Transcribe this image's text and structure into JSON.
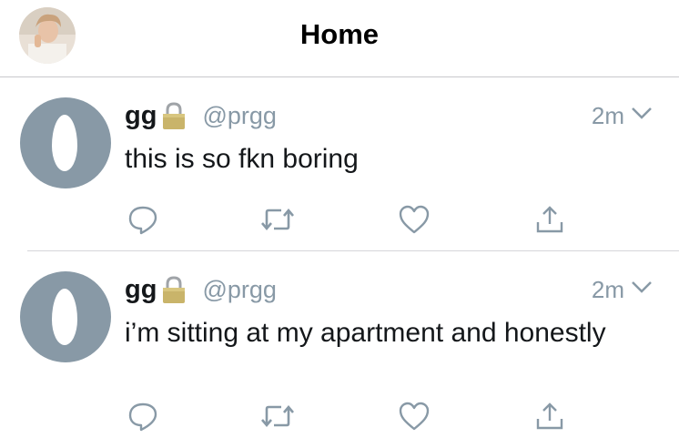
{
  "header": {
    "title": "Home"
  },
  "tweets": [
    {
      "display_name": "gg",
      "handle": "@prgg",
      "time": "2m",
      "text": "this is so fkn boring"
    },
    {
      "display_name": "gg",
      "handle": "@prgg",
      "time": "2m",
      "text": "i’m sitting at my apartment and honestly"
    }
  ],
  "colors": {
    "secondary_text": "#8899a6",
    "default_avatar": "#8899a6",
    "divider": "#c8c8cc"
  },
  "icons": {
    "reply": "reply-icon",
    "retweet": "retweet-icon",
    "like": "heart-icon",
    "share": "share-icon",
    "lock": "lock-icon",
    "menu": "chevron-down-icon"
  }
}
